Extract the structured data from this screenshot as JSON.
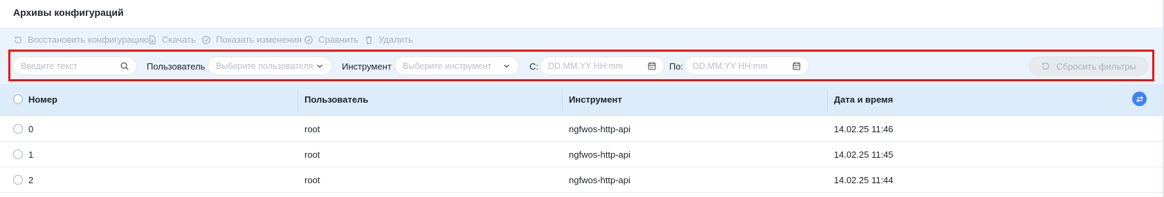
{
  "page": {
    "title": "Архивы конфигураций"
  },
  "toolbar": {
    "restore_label": "Восстановить конфигурацию",
    "download_label": "Скачать",
    "show_changes_label": "Показать изменения",
    "compare_label": "Сравнить",
    "delete_label": "Удалить"
  },
  "filters": {
    "search_placeholder": "Введите текст",
    "user_label": "Пользователь :",
    "user_placeholder": "Выберите пользователя",
    "tool_label": "Инструмент :",
    "tool_placeholder": "Выберите инструмент",
    "from_label": "С:",
    "from_placeholder": "DD.MM.YY HH:mm",
    "to_label": "По:",
    "to_placeholder": "DD.MM.YY HH:mm",
    "reset_label": "Сбросить фильтры"
  },
  "table": {
    "columns": {
      "number": "Номер",
      "user": "Пользователь",
      "tool": "Инструмент",
      "datetime": "Дата и время"
    },
    "rows": [
      {
        "number": "0",
        "user": "root",
        "tool": "ngfwos-http-api",
        "datetime": "14.02.25 11:46"
      },
      {
        "number": "1",
        "user": "root",
        "tool": "ngfwos-http-api",
        "datetime": "14.02.25 11:45"
      },
      {
        "number": "2",
        "user": "root",
        "tool": "ngfwos-http-api",
        "datetime": "14.02.25 11:44"
      }
    ]
  },
  "colors": {
    "toolbar_bg": "#eaf3fb",
    "header_bg": "#dcecfb",
    "highlight_frame": "#ef1010",
    "accent": "#3f82f0",
    "disabled_text": "#a7b1bd"
  },
  "icons": {
    "restore": "restore-icon",
    "download": "download-icon",
    "show_changes": "check-circle-icon",
    "compare": "compare-icon",
    "delete": "trash-icon",
    "search": "search-icon",
    "dropdown": "chevron-down-icon",
    "calendar": "calendar-icon",
    "column_settings": "column-settings-icon"
  }
}
